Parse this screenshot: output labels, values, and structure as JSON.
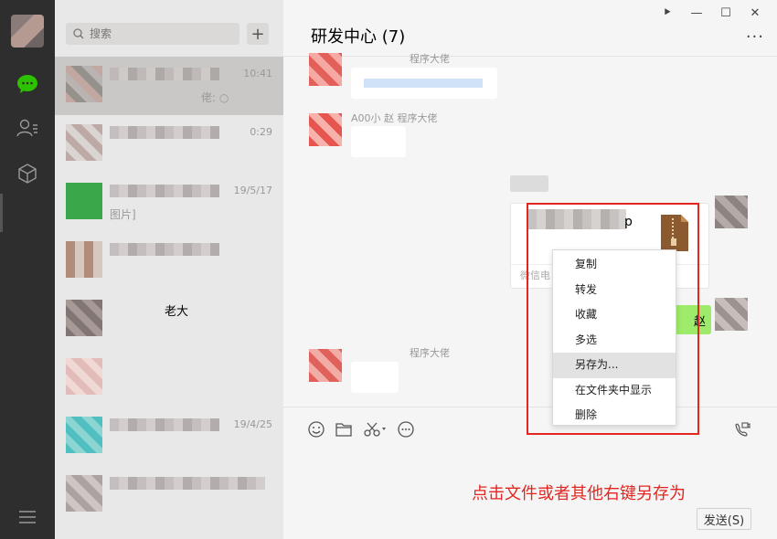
{
  "window": {
    "controls": [
      "⯈",
      "—",
      "☐",
      "✕"
    ]
  },
  "search": {
    "placeholder": "搜索"
  },
  "conversations": [
    {
      "time": "10:41",
      "preview": "佬: ○"
    },
    {
      "time": "0:29",
      "preview": ""
    },
    {
      "time": "19/5/17",
      "preview": "图片]"
    },
    {
      "time": "",
      "preview": ""
    },
    {
      "time": "",
      "name_fragment": "老大"
    },
    {
      "time": "",
      "preview": ""
    },
    {
      "time": "19/4/25",
      "preview": ""
    },
    {
      "time": "",
      "preview": ""
    }
  ],
  "chat": {
    "title": "研发中心 (7)",
    "more": "···",
    "messages": [
      {
        "sender": "程序大佬"
      },
      {
        "sender": "A00小 赵    程序大佬"
      },
      {
        "file_name_suffix": "p",
        "source": "微信电"
      },
      {
        "text": "赵"
      },
      {
        "sender": "程序大佬"
      }
    ],
    "send_label": "发送(S)"
  },
  "context_menu": {
    "items": [
      "复制",
      "转发",
      "收藏",
      "多选",
      "另存为...",
      "在文件夹中显示",
      "删除"
    ],
    "hovered": "另存为..."
  },
  "annotation": "点击文件或者其他右键另存为",
  "colors": {
    "accent_red": "#e3261f",
    "wechat_green": "#2dc100",
    "bubble_green": "#9eea6a"
  }
}
